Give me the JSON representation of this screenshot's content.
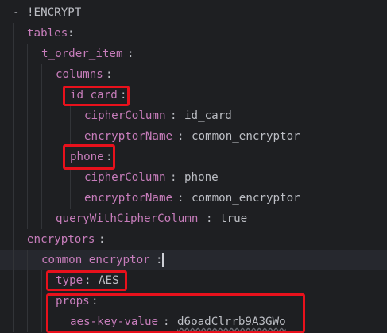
{
  "editor": {
    "lines": [
      {
        "dash": "- ",
        "tag": "!ENCRYPT"
      },
      {
        "key": "tables",
        "sep": ":"
      },
      {
        "key": "t_order_item",
        "sep": ":"
      },
      {
        "key": "columns",
        "sep": ":"
      },
      {
        "key": "id_card",
        "sep": ":"
      },
      {
        "key": "cipherColumn",
        "sep": ": ",
        "value": "id_card"
      },
      {
        "key": "encryptorName",
        "sep": ": ",
        "value": "common_encryptor"
      },
      {
        "key": "phone",
        "sep": ":"
      },
      {
        "key": "cipherColumn",
        "sep": ": ",
        "value": "phone"
      },
      {
        "key": "encryptorName",
        "sep": ": ",
        "value": "common_encryptor"
      },
      {
        "key": "queryWithCipherColumn",
        "sep": ": ",
        "value": "true"
      },
      {
        "key": "encryptors",
        "sep": ":"
      },
      {
        "key": "common_encryptor",
        "sep": ":"
      },
      {
        "key": "type",
        "sep": ": ",
        "value": "AES"
      },
      {
        "key": "props",
        "sep": ":"
      },
      {
        "key": "aes-key-value",
        "sep": ": ",
        "value": "d6oadClrrb9A3GWo"
      }
    ]
  },
  "colors": {
    "background": "#1e1f22",
    "yaml_key": "#c77dbb",
    "text": "#bcbec4",
    "highlight_box": "#e8111c",
    "current_line": "#26282e"
  }
}
